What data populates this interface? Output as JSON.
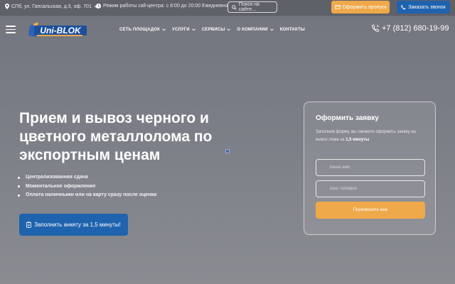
{
  "topbar": {
    "address": "СПб, ул. Гапсальская, д.5, оф. 701",
    "hours": "Режим работы call-центра: с 8:00 до 20:00 Ежедневно",
    "search_placeholder": "Поиск на сайте...",
    "pass_button": "Оформить пропуск",
    "call_button": "Заказать звонок"
  },
  "header": {
    "logo_text": "Uni-BLOK",
    "nav": [
      "СЕТЬ ПЛОЩАДОК",
      "УСЛУГИ",
      "СЕРВИСЫ",
      "О КОМПАНИИ",
      "КОНТАКТЫ"
    ],
    "phone": "+7 (812) 680-19-99"
  },
  "hero": {
    "title": "Прием и вывоз черного и цветного металлолома по экспортным ценам",
    "bullets": [
      "Централизованная сдача",
      "Моментальное оформление",
      "Оплата наличными или на карту сразу после оценки"
    ],
    "cta": "Заполнить анкету за 1,5 минуты!"
  },
  "form": {
    "title": "Оформить заявку",
    "desc_prefix": "Заполнив форму, вы сможете оформить заявку на вывоз лома за ",
    "desc_bold": "1,5 минуты",
    "name_placeholder": "Ваше имя",
    "phone_placeholder": "Ваш телефон",
    "submit": "Перезвоните мне"
  },
  "colors": {
    "accent_orange": "#f0a94a",
    "accent_blue": "#1f63ae",
    "topbar_bg": "#5f6169"
  },
  "icons": [
    "location-icon",
    "chevron-down-icon",
    "clock-icon",
    "search-icon",
    "card-icon",
    "phone-icon",
    "menu-icon",
    "clipboard-icon"
  ]
}
